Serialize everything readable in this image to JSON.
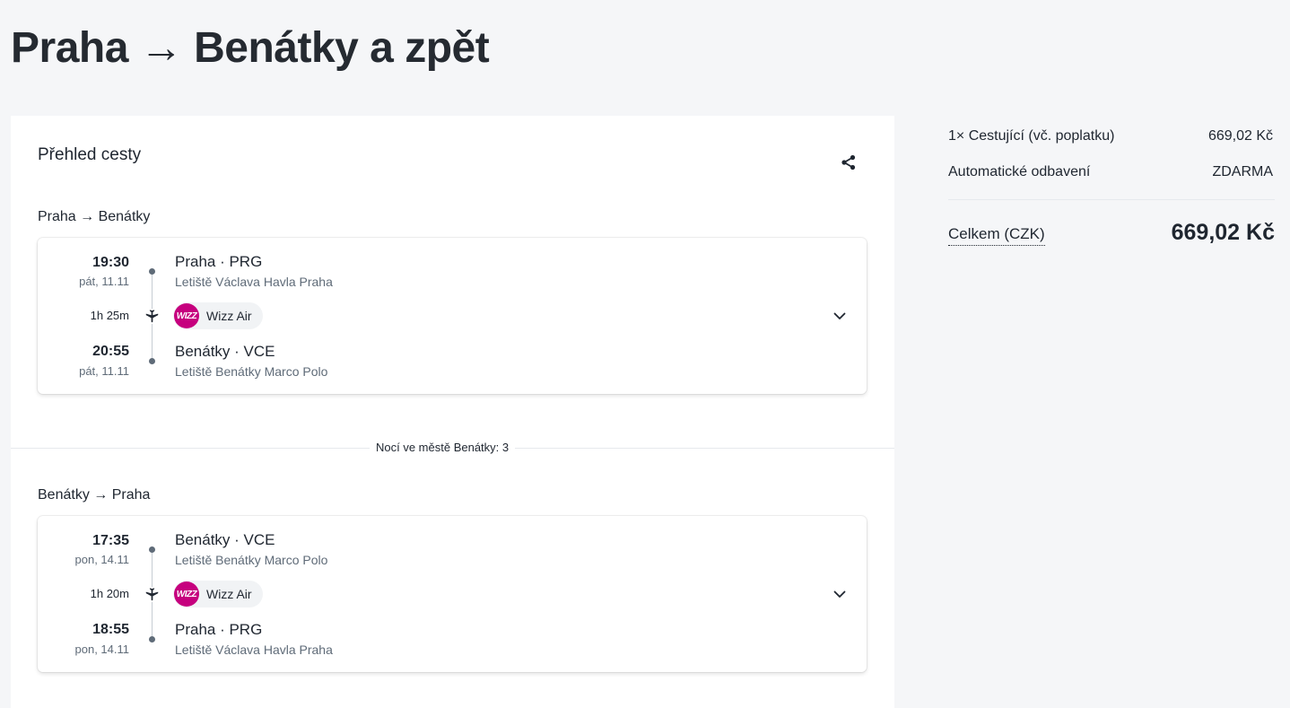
{
  "page": {
    "title": "Praha → Benátky a zpět"
  },
  "overview": {
    "title": "Přehled cesty",
    "share_icon": "share-icon"
  },
  "outbound": {
    "title": "Praha → Benátky",
    "departure": {
      "time": "19:30",
      "date": "pát, 11.11",
      "place": "Praha · PRG",
      "airport": "Letiště Václava Havla Praha"
    },
    "duration": "1h 25m",
    "carrier": {
      "logo_text": "WIZZ",
      "name": "Wizz Air"
    },
    "arrival": {
      "time": "20:55",
      "date": "pát, 11.11",
      "place": "Benátky · VCE",
      "airport": "Letiště Benátky Marco Polo"
    }
  },
  "nights": {
    "label": "Nocí ve městě Benátky: 3"
  },
  "inbound": {
    "title": "Benátky → Praha",
    "departure": {
      "time": "17:35",
      "date": "pon, 14.11",
      "place": "Benátky · VCE",
      "airport": "Letiště Benátky Marco Polo"
    },
    "duration": "1h 20m",
    "carrier": {
      "logo_text": "WIZZ",
      "name": "Wizz Air"
    },
    "arrival": {
      "time": "18:55",
      "date": "pon, 14.11",
      "place": "Praha · PRG",
      "airport": "Letiště Václava Havla Praha"
    }
  },
  "summary": {
    "rows": [
      {
        "label": "1× Cestující (vč. poplatku)",
        "value": "669,02 Kč"
      },
      {
        "label": "Automatické odbavení",
        "value": "ZDARMA"
      }
    ],
    "total_label": "Celkem (CZK)",
    "total_value": "669,02 Kč"
  },
  "colors": {
    "background": "#f5f6f8",
    "card": "#ffffff",
    "text": "#1f2630",
    "secondary_text": "#5f6b78",
    "wizz_brand": "#c6007e"
  }
}
